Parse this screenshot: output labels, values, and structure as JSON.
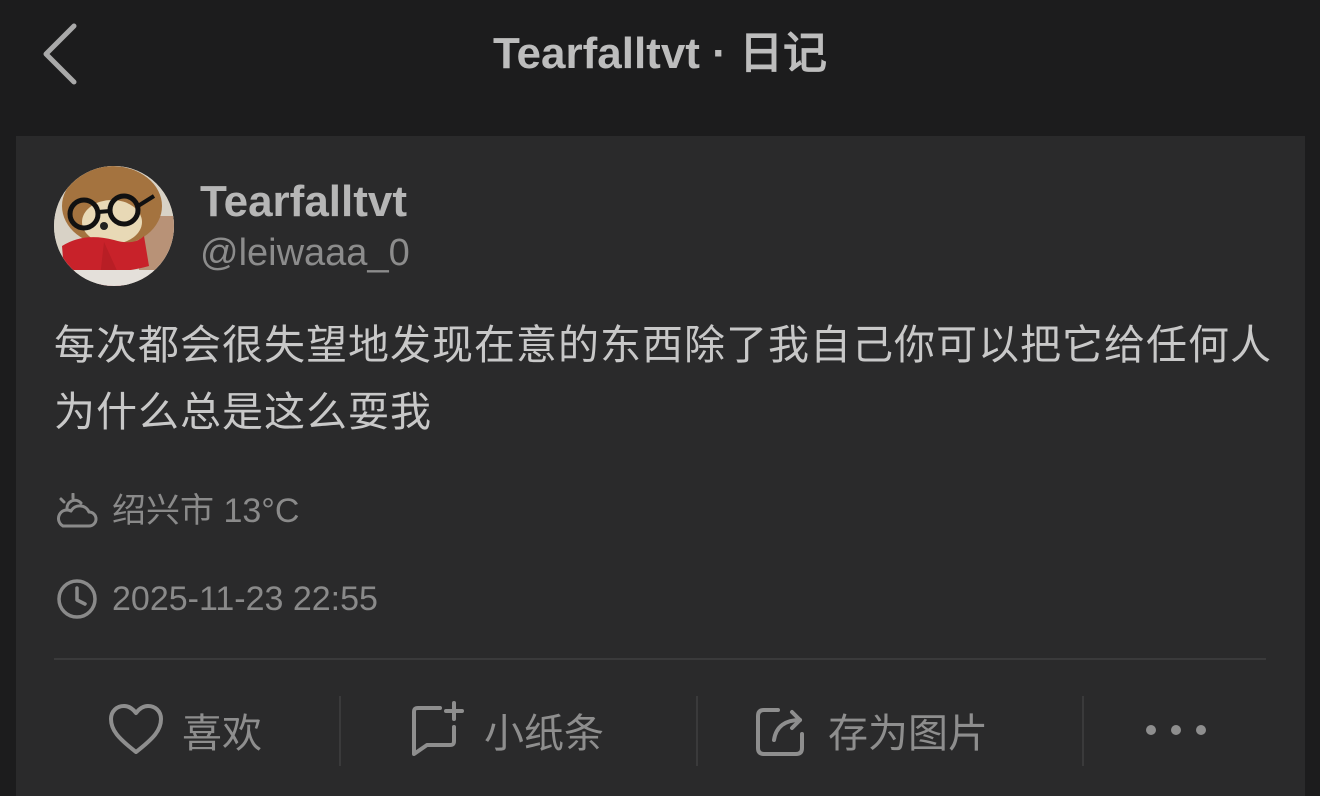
{
  "header": {
    "title": "Tearfalltvt · 日记",
    "back_icon": "chevron-left-icon"
  },
  "post": {
    "author_name": "Tearfalltvt",
    "author_handle": "@leiwaaa_0",
    "content": "每次都会很失望地发现在意的东西除了我自己你可以把它给任何人 为什么总是这么耍我",
    "weather": {
      "icon": "cloud-sun-icon",
      "text": "绍兴市 13°C"
    },
    "timestamp": {
      "icon": "clock-icon",
      "text": "2025-11-23 22:55"
    }
  },
  "actions": {
    "like": {
      "label": "喜欢",
      "icon": "heart-icon"
    },
    "note": {
      "label": "小纸条",
      "icon": "note-add-icon"
    },
    "save_image": {
      "label": "存为图片",
      "icon": "share-export-icon"
    },
    "more": {
      "icon": "more-dots-icon"
    }
  },
  "colors": {
    "background": "#1c1c1d",
    "card": "#2a2a2b",
    "text_primary": "#c8c8c8",
    "text_secondary": "#8c8c8c"
  }
}
